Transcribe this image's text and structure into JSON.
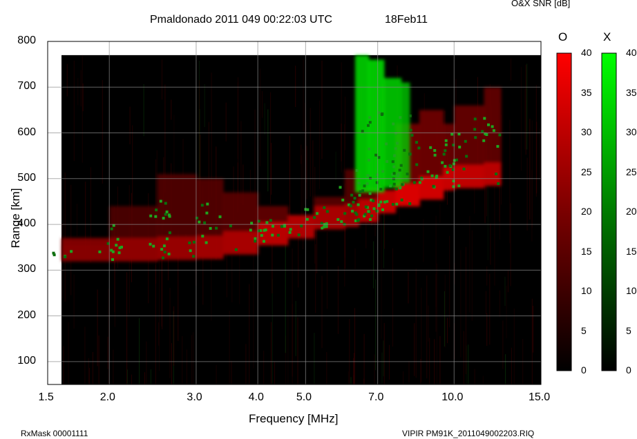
{
  "header": {
    "title": "Pmaldonado 2011 049 00:22:03 UTC",
    "date": "18Feb11",
    "colorbar_title": "O&X SNR [dB]"
  },
  "footer": {
    "left": "RxMask 00001111",
    "right": "VIPIR  PM91K_2011049002203.RIQ"
  },
  "colors": {
    "o_mode": "#ff0000",
    "x_mode": "#00ff00",
    "background": "#000000"
  },
  "chart_data": {
    "type": "heatmap",
    "title": "Pmaldonado 2011 049 00:22:03 UTC",
    "xlabel": "Frequency [MHz]",
    "ylabel": "Range [km]",
    "x_scale": "log",
    "xlim": [
      1.5,
      15.0
    ],
    "ylim": [
      50,
      800
    ],
    "data_ylim": [
      50,
      770
    ],
    "data_xlim": [
      1.6,
      15.0
    ],
    "grid": true,
    "xticks": [
      {
        "value": 1.5,
        "label": "1.5"
      },
      {
        "value": 2.0,
        "label": "2.0"
      },
      {
        "value": 3.0,
        "label": "3.0"
      },
      {
        "value": 4.0,
        "label": "4.0"
      },
      {
        "value": 5.0,
        "label": "5.0"
      },
      {
        "value": 7.0,
        "label": "7.0"
      },
      {
        "value": 10.0,
        "label": "10.0"
      },
      {
        "value": 15.0,
        "label": "15.0"
      }
    ],
    "yticks": [
      {
        "value": 100,
        "label": "100"
      },
      {
        "value": 200,
        "label": "200"
      },
      {
        "value": 300,
        "label": "300"
      },
      {
        "value": 400,
        "label": "400"
      },
      {
        "value": 500,
        "label": "500"
      },
      {
        "value": 600,
        "label": "600"
      },
      {
        "value": 700,
        "label": "700"
      },
      {
        "value": 800,
        "label": "800"
      }
    ],
    "colorbars": [
      {
        "name": "O",
        "color": "#ff0000",
        "range": [
          0,
          40
        ],
        "ticks": [
          "0",
          "5",
          "10",
          "15",
          "20",
          "25",
          "30",
          "35",
          "40"
        ],
        "tick_values": [
          0,
          5,
          10,
          15,
          20,
          25,
          30,
          35,
          40
        ]
      },
      {
        "name": "X",
        "color": "#00ff00",
        "range": [
          0,
          40
        ],
        "ticks": [
          "0",
          "5",
          "10",
          "15",
          "20",
          "25",
          "30",
          "35",
          "40"
        ],
        "tick_values": [
          0,
          5,
          10,
          15,
          20,
          25,
          30,
          35,
          40
        ]
      }
    ],
    "o_trace": [
      {
        "f": 1.6,
        "h": 325,
        "top": 355,
        "snr": 14
      },
      {
        "f": 2.0,
        "h": 325,
        "top": 440,
        "snr": 16
      },
      {
        "f": 2.5,
        "h": 328,
        "top": 510,
        "snr": 18
      },
      {
        "f": 3.0,
        "h": 330,
        "top": 500,
        "snr": 20
      },
      {
        "f": 3.4,
        "h": 340,
        "top": 470,
        "snr": 22
      },
      {
        "f": 4.0,
        "h": 360,
        "top": 440,
        "snr": 26
      },
      {
        "f": 4.6,
        "h": 375,
        "top": 420,
        "snr": 24
      },
      {
        "f": 5.2,
        "h": 395,
        "top": 460,
        "snr": 22
      },
      {
        "f": 6.0,
        "h": 400,
        "top": 520,
        "snr": 20
      },
      {
        "f": 6.4,
        "h": 410,
        "top": 480,
        "snr": 26
      },
      {
        "f": 7.0,
        "h": 430,
        "top": 470,
        "snr": 30
      },
      {
        "f": 7.6,
        "h": 445,
        "top": 620,
        "snr": 34
      },
      {
        "f": 8.5,
        "h": 460,
        "top": 650,
        "snr": 32
      },
      {
        "f": 9.5,
        "h": 480,
        "top": 620,
        "snr": 30
      },
      {
        "f": 10.0,
        "h": 485,
        "top": 660,
        "snr": 28
      },
      {
        "f": 11.5,
        "h": 490,
        "top": 700,
        "snr": 26
      }
    ],
    "x_trace": [
      {
        "f": 6.3,
        "h": 470,
        "top": 770,
        "snr": 36
      },
      {
        "f": 6.7,
        "h": 470,
        "top": 760,
        "snr": 38
      },
      {
        "f": 7.2,
        "h": 480,
        "top": 720,
        "snr": 34
      },
      {
        "f": 7.8,
        "h": 490,
        "top": 710,
        "snr": 28
      }
    ]
  }
}
